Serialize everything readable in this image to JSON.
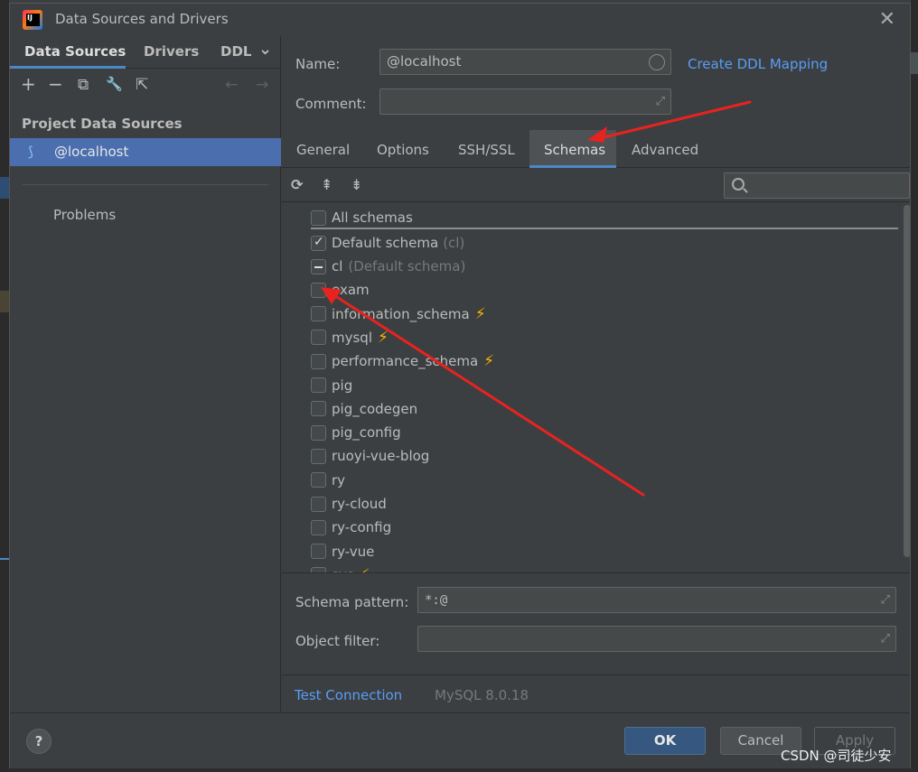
{
  "window": {
    "title": "Data Sources and Drivers",
    "close_glyph": "✕"
  },
  "left_panel": {
    "tabs": [
      {
        "label": "Data Sources"
      },
      {
        "label": "Drivers"
      },
      {
        "label": "DDL"
      }
    ],
    "tabs_more_glyph": "⌄",
    "toolbar": {
      "add": "+",
      "remove": "−",
      "copy": "⧉",
      "settings": "🔧",
      "export": "⇱",
      "back": "←",
      "forward": "→"
    },
    "section_title": "Project Data Sources",
    "data_source": {
      "label": "@localhost",
      "icon_glyph": "⟆"
    },
    "problems_label": "Problems"
  },
  "form": {
    "name_label": "Name:",
    "name_value": "@localhost",
    "comment_label": "Comment:",
    "comment_value": "",
    "create_ddl_link": "Create DDL Mapping",
    "expand_glyph": "⤢"
  },
  "tabs": [
    {
      "label": "General"
    },
    {
      "label": "Options"
    },
    {
      "label": "SSH/SSL"
    },
    {
      "label": "Schemas"
    },
    {
      "label": "Advanced"
    }
  ],
  "schemas_toolbar": {
    "refresh": "⟳",
    "expand_all": "⇞",
    "collapse_all": "⇟",
    "search_value": ""
  },
  "schemas": {
    "all_label": "All schemas",
    "default_label": "Default schema",
    "default_note": "(cl)",
    "items": [
      {
        "name": "cl",
        "note": "(Default schema)",
        "state": "partial",
        "bolt": false
      },
      {
        "name": "exam",
        "note": "",
        "state": "unchecked",
        "bolt": false
      },
      {
        "name": "information_schema",
        "note": "",
        "state": "unchecked",
        "bolt": true
      },
      {
        "name": "mysql",
        "note": "",
        "state": "unchecked",
        "bolt": true
      },
      {
        "name": "performance_schema",
        "note": "",
        "state": "unchecked",
        "bolt": true
      },
      {
        "name": "pig",
        "note": "",
        "state": "unchecked",
        "bolt": false
      },
      {
        "name": "pig_codegen",
        "note": "",
        "state": "unchecked",
        "bolt": false
      },
      {
        "name": "pig_config",
        "note": "",
        "state": "unchecked",
        "bolt": false
      },
      {
        "name": "ruoyi-vue-blog",
        "note": "",
        "state": "unchecked",
        "bolt": false
      },
      {
        "name": "ry",
        "note": "",
        "state": "unchecked",
        "bolt": false
      },
      {
        "name": "ry-cloud",
        "note": "",
        "state": "unchecked",
        "bolt": false
      },
      {
        "name": "ry-config",
        "note": "",
        "state": "unchecked",
        "bolt": false
      },
      {
        "name": "ry-vue",
        "note": "",
        "state": "unchecked",
        "bolt": false
      },
      {
        "name": "sys",
        "note": "",
        "state": "unchecked",
        "bolt": true
      }
    ],
    "bolt_glyph": "⚡"
  },
  "filters": {
    "schema_pattern_label": "Schema pattern:",
    "schema_pattern_value": "*:@",
    "object_filter_label": "Object filter:",
    "object_filter_value": ""
  },
  "status": {
    "test_connection": "Test Connection",
    "driver_version": "MySQL 8.0.18"
  },
  "footer": {
    "help": "?",
    "ok": "OK",
    "cancel": "Cancel",
    "apply": "Apply"
  },
  "watermark": "CSDN @司徒少安",
  "colors": {
    "accent": "#4a88c7",
    "link": "#589df6",
    "annotation_arrow": "#e8231f",
    "bolt": "#f4b400"
  }
}
